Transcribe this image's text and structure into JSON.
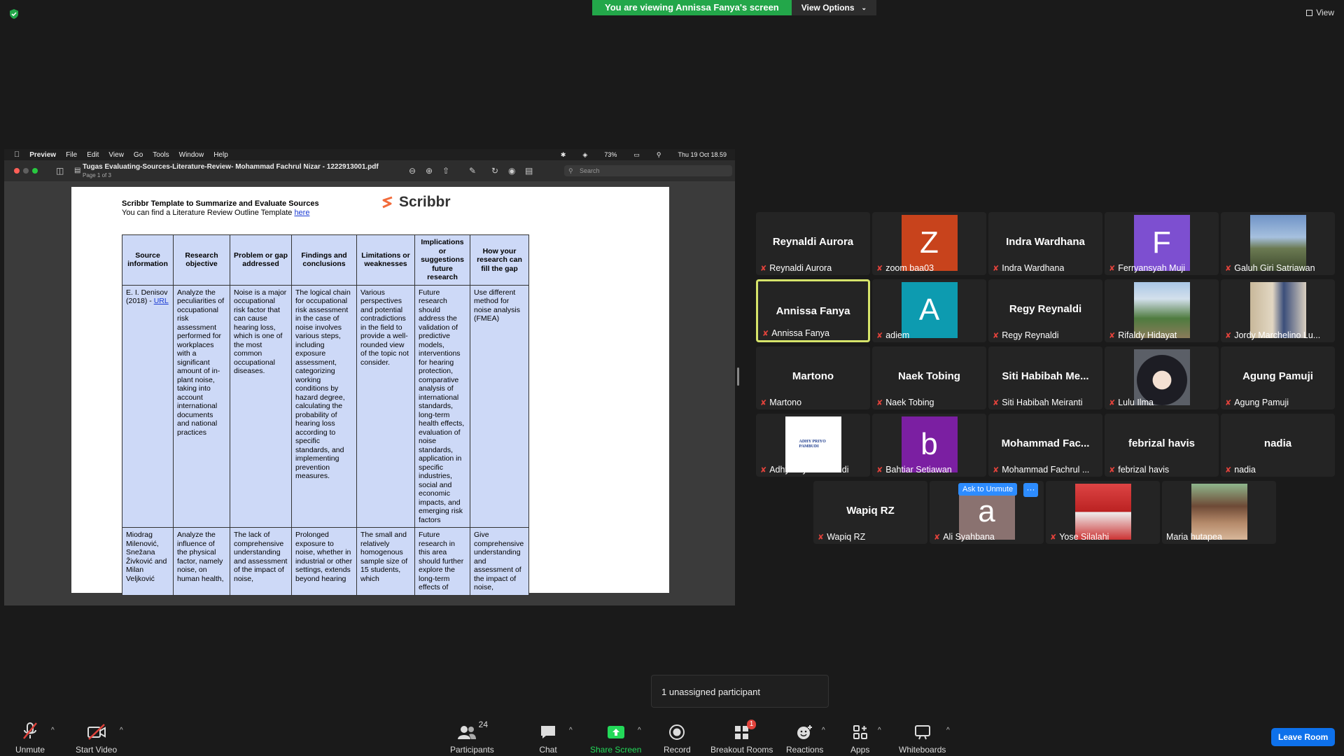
{
  "banner": {
    "viewing": "You are viewing Annissa Fanya's screen",
    "options": "View Options"
  },
  "view_button": "View",
  "mac": {
    "menu": [
      "Preview",
      "File",
      "Edit",
      "View",
      "Go",
      "Tools",
      "Window",
      "Help"
    ],
    "battery": "73%",
    "datetime": "Thu 19 Oct  18.59"
  },
  "preview": {
    "title": "Tugas Evaluating-Sources-Literature-Review- Mohammad Fachrul Nizar - 1222913001.pdf",
    "page_indicator": "Page 1 of 3",
    "search_placeholder": "Search"
  },
  "pdf": {
    "heading": "Scribbr Template to Summarize and Evaluate Sources",
    "subtitle": "You can find a Literature Review Outline Template",
    "subtitle_link": "here",
    "logo": "Scribbr",
    "headers": [
      "Source information",
      "Research objective",
      "Problem or gap addressed",
      "Findings and conclusions",
      "Limitations or weaknesses",
      "Implications or suggestions future research",
      "How your research can fill the gap"
    ],
    "row1": {
      "source": "E. I. Denisov (2018) -",
      "source_link": "URL",
      "cells": [
        "Analyze the peculiarities of occupational risk assessment performed for workplaces with a significant amount of in-plant noise, taking into account international documents and national practices",
        "Noise is a major occupational risk factor that can cause hearing loss, which is one of the most common occupational diseases.",
        "The logical chain for occupational risk assessment in the case of noise involves various steps, including exposure assessment, categorizing working conditions by hazard degree, calculating the probability of hearing loss according to specific standards, and implementing prevention measures.",
        "Various perspectives and potential contradictions in the field to provide a well-rounded view of the topic not consider.",
        "Future research should address the validation of predictive models, interventions for hearing protection, comparative analysis of international standards, long-term health effects, evaluation of noise standards, application in specific industries, social and economic impacts, and emerging risk factors",
        "Use different method for noise analysis (FMEA)"
      ]
    },
    "row2": {
      "cells": [
        "Miodrag Milenović, Snežana Živković and Milan Veljković",
        "Analyze the influence of the physical factor, namely noise, on human health,",
        "The lack of comprehensive understanding and assessment of the impact of noise,",
        "Prolonged exposure to noise, whether in industrial or other settings, extends beyond hearing",
        "The small and relatively homogenous sample size of 15 students, which",
        "Future research in this area should further explore the long-term effects of",
        "Give comprehensive understanding and assessment of the impact of noise,"
      ]
    }
  },
  "participants": [
    {
      "name": "Reynaldi Aurora",
      "label": "Reynaldi Aurora",
      "type": "name"
    },
    {
      "name": "Z",
      "label": "zoom baa03",
      "type": "letter",
      "color": "#c8431c"
    },
    {
      "name": "Indra Wardhana",
      "label": "Indra Wardhana",
      "type": "name"
    },
    {
      "name": "F",
      "label": "Ferryansyah Muji",
      "type": "letter",
      "color": "#7d4fd0"
    },
    {
      "name": "",
      "label": "Galuh Giri Satriawan",
      "type": "photo",
      "photo": "mountain"
    },
    {
      "name": "Annissa Fanya",
      "label": "Annissa Fanya",
      "type": "name",
      "active": true
    },
    {
      "name": "A",
      "label": "adiem",
      "type": "letter",
      "color": "#0d9bb0"
    },
    {
      "name": "Regy Reynaldi",
      "label": "Regy Reynaldi",
      "type": "name"
    },
    {
      "name": "",
      "label": "Rifaldy Hidayat",
      "type": "photo",
      "photo": "outdoor"
    },
    {
      "name": "",
      "label": "Jordy Marchelino Lu...",
      "type": "photo",
      "photo": "indoor"
    },
    {
      "name": "Martono",
      "label": "Martono",
      "type": "name"
    },
    {
      "name": "Naek Tobing",
      "label": "Naek Tobing",
      "type": "name"
    },
    {
      "name": "Siti Habibah Me...",
      "label": "Siti Habibah Meiranti",
      "type": "name"
    },
    {
      "name": "",
      "label": "Lulu Ilma",
      "type": "photo",
      "photo": "hijab"
    },
    {
      "name": "Agung Pamuji",
      "label": "Agung Pamuji",
      "type": "name"
    },
    {
      "name": "ADHY PRIYO PAMBUDI",
      "label": "Adhy Priyo Pambudi",
      "type": "logo"
    },
    {
      "name": "b",
      "label": "Bahtiar Setiawan",
      "type": "letter",
      "color": "#7b1fa2"
    },
    {
      "name": "Mohammad Fac...",
      "label": "Mohammad Fachrul ...",
      "type": "name"
    },
    {
      "name": "febrizal havis",
      "label": "febrizal havis",
      "type": "name"
    },
    {
      "name": "nadia",
      "label": "nadia",
      "type": "name"
    },
    {
      "name": "Wapiq RZ",
      "label": "Wapiq RZ",
      "type": "name"
    },
    {
      "name": "a",
      "label": "Ali Syahbana",
      "type": "letter",
      "color": "#8a7270"
    },
    {
      "name": "",
      "label": "Yose Silalahi",
      "type": "photo",
      "photo": "red"
    },
    {
      "name": "",
      "label": "Maria hutapea",
      "type": "photo",
      "photo": "house",
      "mic_on": true
    }
  ],
  "ask_to_unmute": "Ask to Unmute",
  "ask_more": "···",
  "toast": "1 unassigned participant",
  "toolbar": {
    "unmute": "Unmute",
    "start_video": "Start Video",
    "participants": "Participants",
    "participants_count": "24",
    "chat": "Chat",
    "share_screen": "Share Screen",
    "record": "Record",
    "breakout": "Breakout Rooms",
    "breakout_badge": "1",
    "reactions": "Reactions",
    "apps": "Apps",
    "whiteboards": "Whiteboards",
    "leave": "Leave Room"
  },
  "colors": {
    "banner_green": "#23a74a",
    "share_green": "#23d959",
    "leave_blue": "#0e71eb",
    "active_border": "#d6e46a",
    "mic_off_red": "#e0423b"
  }
}
